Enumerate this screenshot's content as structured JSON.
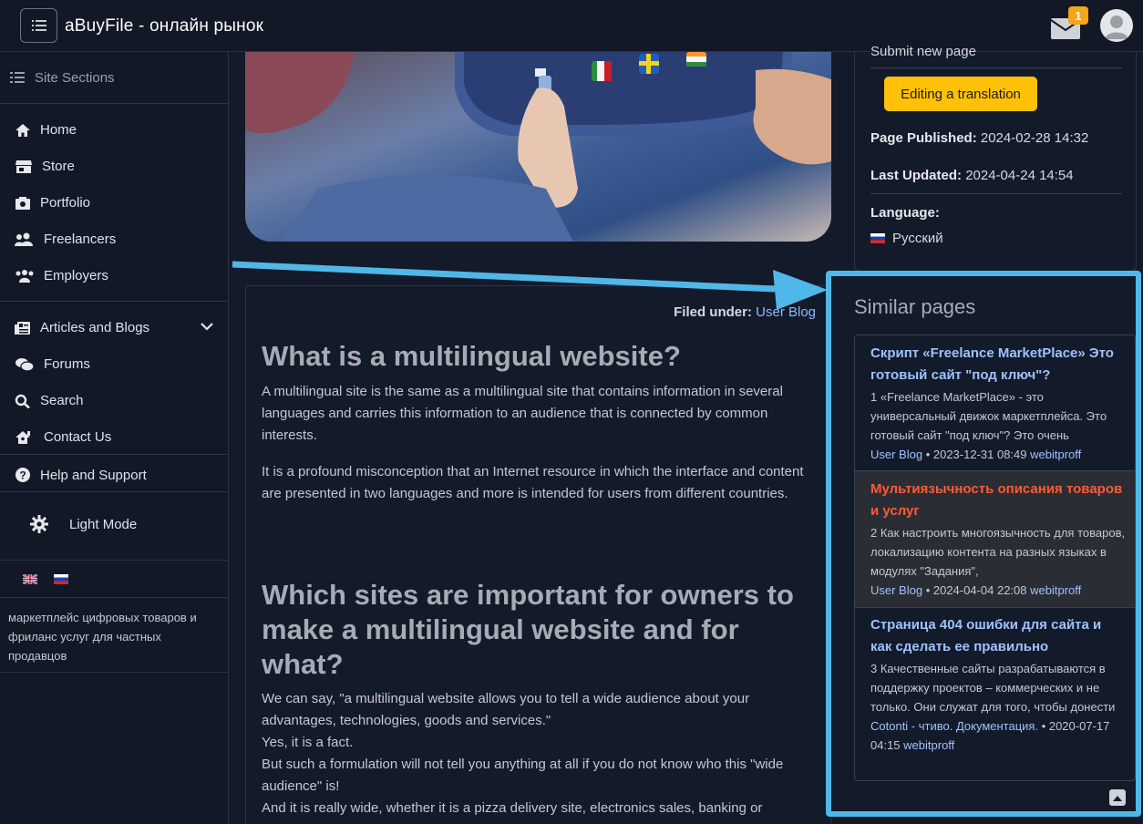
{
  "header": {
    "title": "aBuyFile - онлайн рынок",
    "notification_count": "1"
  },
  "sidebar": {
    "sections_label": "Site Sections",
    "items": [
      {
        "label": "Home",
        "icon": "home-icon"
      },
      {
        "label": "Store",
        "icon": "store-icon"
      },
      {
        "label": "Portfolio",
        "icon": "portfolio-icon"
      },
      {
        "label": "Freelancers",
        "icon": "freelancers-icon"
      },
      {
        "label": "Employers",
        "icon": "employers-icon"
      },
      {
        "label": "Articles and Blogs",
        "icon": "articles-icon"
      },
      {
        "label": "Forums",
        "icon": "forums-icon"
      },
      {
        "label": "Search",
        "icon": "search-icon"
      },
      {
        "label": "Contact Us",
        "icon": "contact-icon"
      },
      {
        "label": "Help and Support",
        "icon": "help-icon"
      }
    ],
    "light_mode_label": "Light Mode",
    "description": "маркетплейс цифровых товаров и фриланс услуг для частных продавцов"
  },
  "info": {
    "submit_link": "Submit new page",
    "edit_translation": "Editing a translation",
    "published_label": "Page Published:",
    "published_value": "2024-02-28 14:32",
    "updated_label": "Last Updated:",
    "updated_value": "2024-04-24 14:54",
    "language_label": "Language:",
    "language_value": "Русский"
  },
  "article": {
    "filed_label": "Filed under:",
    "filed_value": "User Blog",
    "h1": "What is a multilingual website?",
    "p1": "A multilingual site is the same as a multilingual site that contains information in several languages and carries this information to an audience that is connected by common interests.",
    "p2": "It is a profound misconception that an Internet resource in which the interface and content are presented in two languages and more is intended for users from different countries.",
    "h2": "Which sites are important for owners to make a multilingual website and for what?",
    "p3_1": "We can say, \"a multilingual website allows you to tell a wide audience about your advantages, technologies, goods and services.\"",
    "p3_2": "Yes, it is a fact.",
    "p3_3": "But such a formulation will not tell you anything at all if you do not know who this \"wide audience\" is!",
    "p3_4": "And it is really wide, whether it is a pizza delivery site, electronics sales, banking or"
  },
  "similar": {
    "title": "Similar pages",
    "items": [
      {
        "title": "Скрипт «Freelance MarketPlace» Это готовый сайт \"под ключ\"?",
        "desc": "1 «Freelance MarketPlace» - это универсальный движок маркетплейса. Это готовый сайт \"под ключ\"? Это очень",
        "category": "User Blog",
        "date": "• 2023-12-31 08:49",
        "author": "webitproff"
      },
      {
        "title": "Мультиязычность описания товаров и услуг",
        "desc": "2 Как настроить многоязычность для товаров, локализацию контента на разных языках в модулях \"Задания\",",
        "category": "User Blog",
        "date": "• 2024-04-04 22:08",
        "author": "webitproff"
      },
      {
        "title": "Страница 404 ошибки для сайта и как сделать ее правильно",
        "desc": "3 Качественные сайты разрабатываются в поддержку проектов – коммерческих и не только. Они служат для того, чтобы донести",
        "category": "Cotonti - чтиво. Документация.",
        "date": "• 2020-07-17 04:15",
        "author": "webitproff"
      }
    ]
  },
  "colors": {
    "background": "#131a2a",
    "accent_yellow": "#ffc107",
    "link": "#9ec3ff",
    "active_title": "#ff5a36",
    "annotation": "#4fb8e8"
  }
}
